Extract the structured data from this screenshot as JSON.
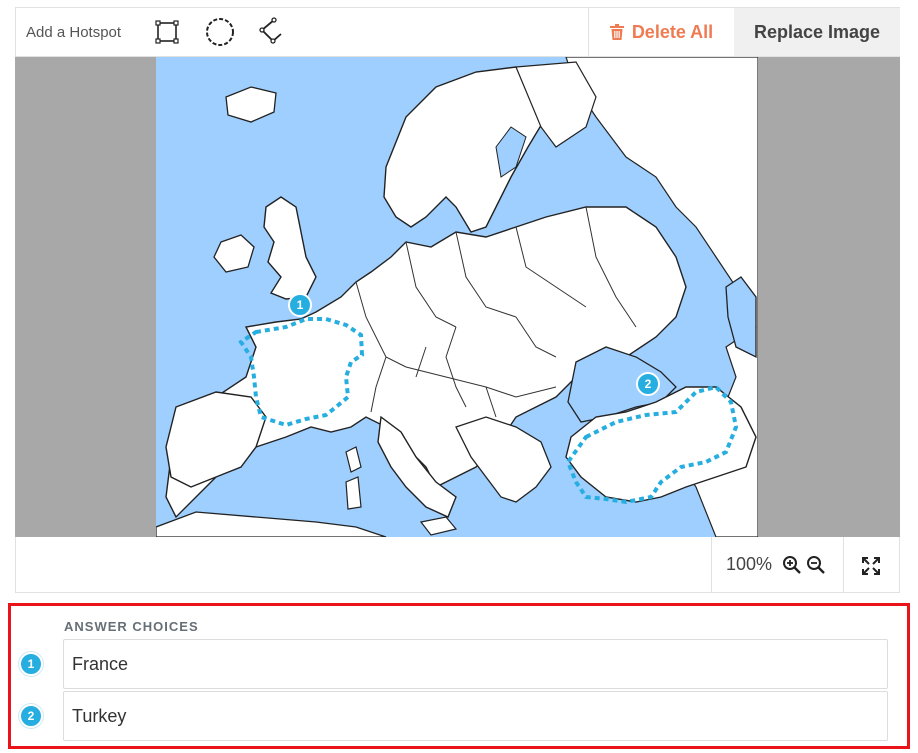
{
  "toolbar": {
    "add_hotspot_label": "Add a Hotspot",
    "tools": [
      {
        "name": "rectangle-tool",
        "icon": "rectangle-select-icon"
      },
      {
        "name": "circle-tool",
        "icon": "circle-select-icon"
      },
      {
        "name": "polygon-tool",
        "icon": "polygon-select-icon"
      }
    ],
    "delete_all_label": "Delete All",
    "replace_image_label": "Replace Image"
  },
  "canvas": {
    "image_subject": "Map of Europe",
    "hotspots": [
      {
        "number": "1",
        "region": "France"
      },
      {
        "number": "2",
        "region": "Turkey"
      }
    ]
  },
  "zoom": {
    "level": "100%",
    "zoom_in_icon": "zoom-in-icon",
    "zoom_out_icon": "zoom-out-icon",
    "fullscreen_icon": "expand-icon"
  },
  "answers": {
    "heading": "ANSWER CHOICES",
    "items": [
      {
        "number": "1",
        "value": "France"
      },
      {
        "number": "2",
        "value": "Turkey"
      }
    ]
  },
  "colors": {
    "accent": "#27aee1",
    "delete": "#ef7b53",
    "water": "#9fcfff",
    "highlight_border": "#e8141a"
  }
}
